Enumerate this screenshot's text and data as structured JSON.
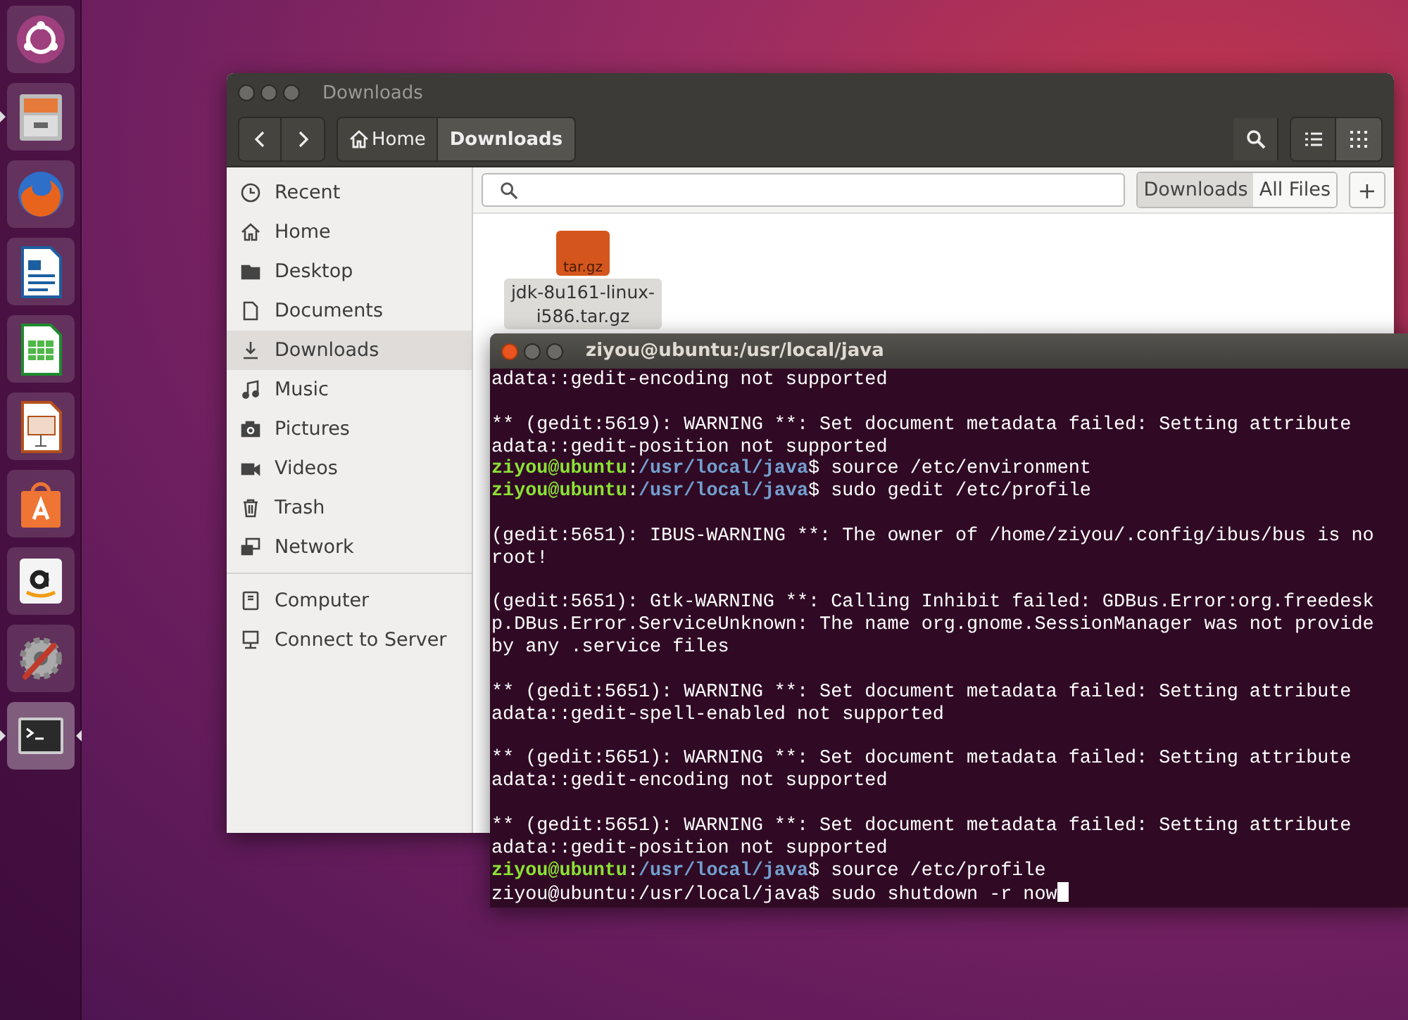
{
  "launcher": [
    {
      "kind": "dash",
      "running": false,
      "focused": false
    },
    {
      "kind": "files",
      "running": true,
      "focused": false
    },
    {
      "kind": "firefox",
      "running": false,
      "focused": false
    },
    {
      "kind": "writer",
      "running": false,
      "focused": false
    },
    {
      "kind": "calc",
      "running": false,
      "focused": false
    },
    {
      "kind": "impress",
      "running": false,
      "focused": false
    },
    {
      "kind": "software",
      "running": false,
      "focused": false
    },
    {
      "kind": "amazon",
      "running": false,
      "focused": false
    },
    {
      "kind": "settings",
      "running": false,
      "focused": false
    },
    {
      "kind": "terminal",
      "running": true,
      "focused": true
    }
  ],
  "file_manager": {
    "title": "Downloads",
    "active": false,
    "path": [
      {
        "label": "Home",
        "kind": "home",
        "selected": false
      },
      {
        "label": "Downloads",
        "kind": "folder",
        "selected": true
      }
    ],
    "view": [
      {
        "kind": "list",
        "selected": false
      },
      {
        "kind": "grid",
        "selected": true
      }
    ],
    "sidebar": [
      {
        "kind": "recent",
        "label": "Recent",
        "selected": false
      },
      {
        "kind": "home",
        "label": "Home",
        "selected": false
      },
      {
        "kind": "folder",
        "label": "Desktop",
        "selected": false
      },
      {
        "kind": "document",
        "label": "Documents",
        "selected": false
      },
      {
        "kind": "download",
        "label": "Downloads",
        "selected": true
      },
      {
        "kind": "music",
        "label": "Music",
        "selected": false
      },
      {
        "kind": "camera",
        "label": "Pictures",
        "selected": false
      },
      {
        "kind": "video",
        "label": "Videos",
        "selected": false
      },
      {
        "kind": "trash",
        "label": "Trash",
        "selected": false
      },
      {
        "kind": "network",
        "label": "Network",
        "selected": false
      },
      {
        "kind": "computer",
        "label": "Computer",
        "selected": false,
        "group_start": true
      },
      {
        "kind": "server",
        "label": "Connect to Server",
        "selected": false
      }
    ],
    "scope": [
      {
        "label": "Downloads",
        "selected": true
      },
      {
        "label": "All Files",
        "selected": false
      }
    ],
    "add_button": "+",
    "files": [
      {
        "name": "jdk-8u161-linux-i586.tar.gz",
        "badge": "tar.gz",
        "selected": true
      }
    ]
  },
  "terminal": {
    "title": "ziyou@ubuntu:/usr/local/java",
    "active": true,
    "cursor": true,
    "lines": [
      {
        "kind": "output",
        "text": "adata::gedit-encoding not supported"
      },
      {
        "kind": "blank"
      },
      {
        "kind": "output",
        "text": "** (gedit:5619): WARNING **: Set document metadata failed: Setting attribute"
      },
      {
        "kind": "output",
        "text": "adata::gedit-position not supported"
      },
      {
        "kind": "prompt",
        "user": "ziyou@ubuntu",
        "sep": ":",
        "path": "/usr/local/java",
        "command": "$ source /etc/environment"
      },
      {
        "kind": "prompt",
        "user": "ziyou@ubuntu",
        "sep": ":",
        "path": "/usr/local/java",
        "command": "$ sudo gedit /etc/profile"
      },
      {
        "kind": "blank"
      },
      {
        "kind": "output",
        "text": "(gedit:5651): IBUS-WARNING **: The owner of /home/ziyou/.config/ibus/bus is no"
      },
      {
        "kind": "output",
        "text": "root!"
      },
      {
        "kind": "blank"
      },
      {
        "kind": "output",
        "text": "(gedit:5651): Gtk-WARNING **: Calling Inhibit failed: GDBus.Error:org.freedesk"
      },
      {
        "kind": "output",
        "text": "p.DBus.Error.ServiceUnknown: The name org.gnome.SessionManager was not provide"
      },
      {
        "kind": "output",
        "text": "by any .service files"
      },
      {
        "kind": "blank"
      },
      {
        "kind": "output",
        "text": "** (gedit:5651): WARNING **: Set document metadata failed: Setting attribute"
      },
      {
        "kind": "output",
        "text": "adata::gedit-spell-enabled not supported"
      },
      {
        "kind": "blank"
      },
      {
        "kind": "output",
        "text": "** (gedit:5651): WARNING **: Set document metadata failed: Setting attribute"
      },
      {
        "kind": "output",
        "text": "adata::gedit-encoding not supported"
      },
      {
        "kind": "blank"
      },
      {
        "kind": "output",
        "text": "** (gedit:5651): WARNING **: Set document metadata failed: Setting attribute"
      },
      {
        "kind": "output",
        "text": "adata::gedit-position not supported"
      },
      {
        "kind": "prompt",
        "user": "ziyou@ubuntu",
        "sep": ":",
        "path": "/usr/local/java",
        "command": "$ source /etc/profile"
      },
      {
        "kind": "output",
        "text": "ziyou@ubuntu:/usr/local/java$ sudo shutdown -r now"
      }
    ]
  }
}
